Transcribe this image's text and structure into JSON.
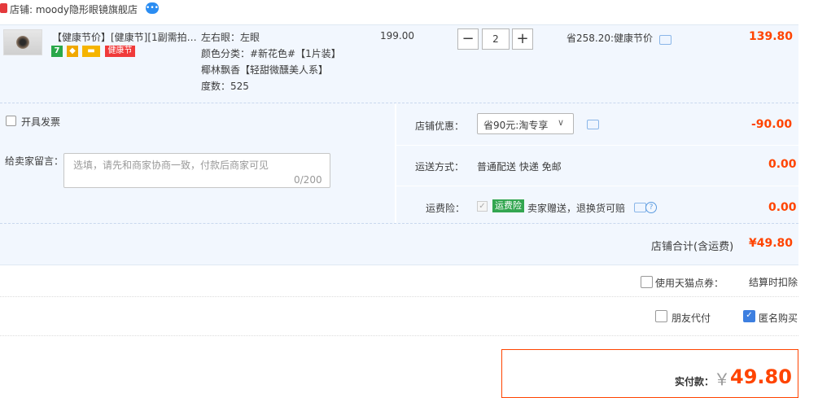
{
  "shop": {
    "label": "店铺: moody隐形眼镜旗舰店"
  },
  "item": {
    "title": "【健康节价】[健康节][1副需拍…",
    "badges": {
      "seven": "7",
      "health": "健康节"
    },
    "specs": [
      "左右眼：左眼",
      "颜色分类：#新花色#【1片装】",
      "椰林飘香【轻甜微醺美人系】",
      "度数：525"
    ],
    "unit_price": "199.00",
    "quantity": "2",
    "qty_minus": "−",
    "qty_plus": "+",
    "saving": "省258.20:健康节价",
    "subtotal": "139.80"
  },
  "options": {
    "invoice_label": "开具发票",
    "message_label": "给卖家留言：",
    "message_placeholder": "选填，请先和商家协商一致，付款后商家可见",
    "message_count": "0/200",
    "discount_label": "店铺优惠：",
    "discount_selected": "省90元:淘专享",
    "discount_amount": "-90.00",
    "shipping_label": "运送方式：",
    "shipping_value": "普通配送 快递 免邮",
    "shipping_amount": "0.00",
    "insurance_label": "运费险：",
    "insurance_badge": "运费险",
    "insurance_text": "卖家赠送，退换货可赔",
    "insurance_amount": "0.00"
  },
  "totals": {
    "shop_total_label": "店铺合计(含运费)",
    "shop_total_value": "¥49.80",
    "tmall_points_label": "使用天猫点券：",
    "tmall_points_value": "结算时扣除",
    "friend_pay_label": "朋友代付",
    "anonymous_label": "匿名购买",
    "pay_label": "实付款：",
    "pay_currency": "￥",
    "pay_amount": "49.80"
  },
  "colors": {
    "accent": "#ff4400",
    "panel": "#f2f7fe",
    "checkbox": "#3d7fe0"
  },
  "icons": [
    "shop-icon",
    "chat-icon",
    "help-icon",
    "chevron-down-icon",
    "check-icon"
  ]
}
